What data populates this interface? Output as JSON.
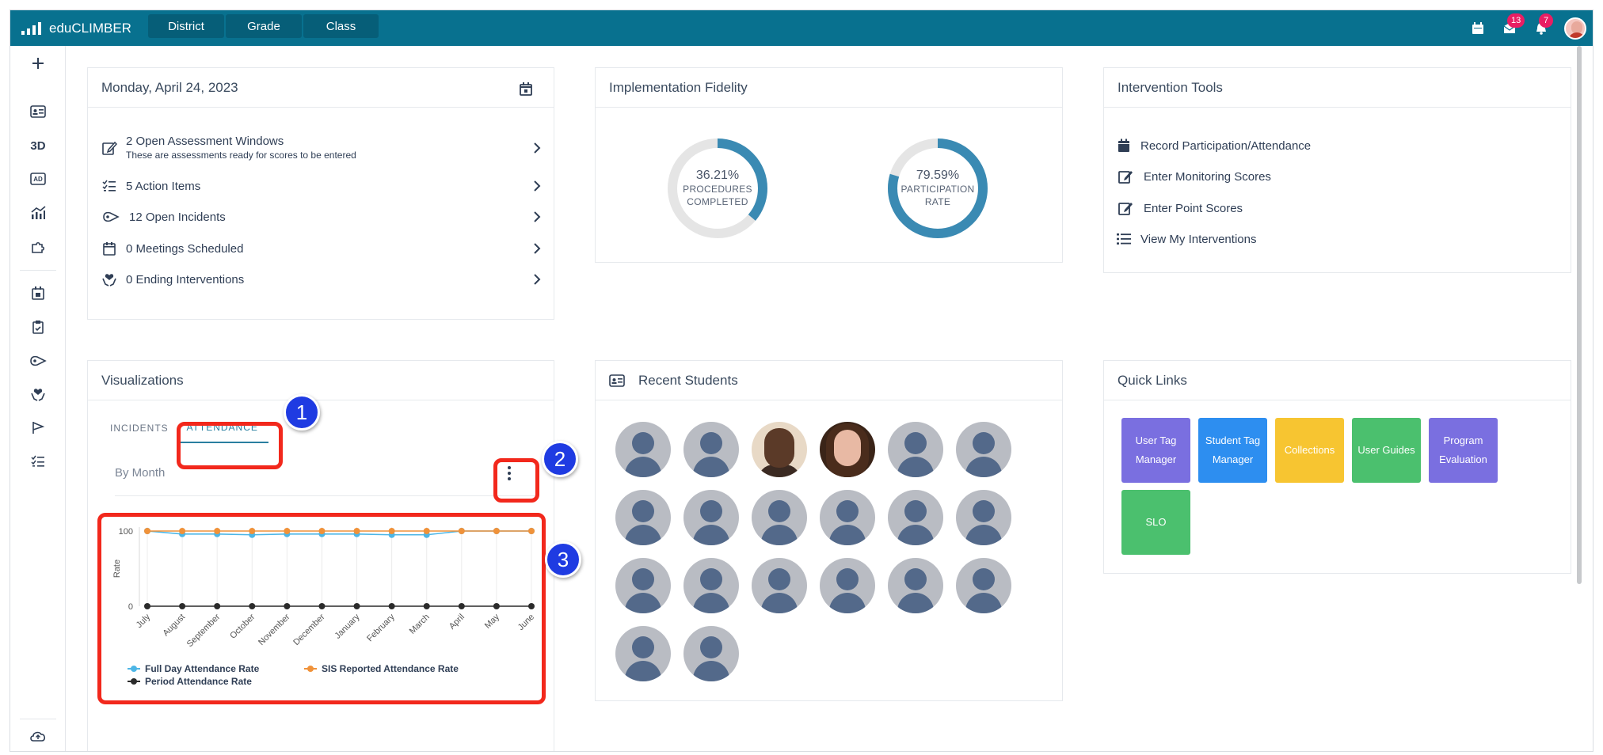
{
  "app": {
    "name": "eduCLIMBER"
  },
  "nav": {
    "tabs": [
      "District",
      "Grade",
      "Class"
    ]
  },
  "topbar": {
    "mail_badge": "13",
    "bell_badge": "7"
  },
  "sidebar": {
    "three_d_label": "3D"
  },
  "today": {
    "date": "Monday, April 24, 2023",
    "items": [
      {
        "label": "2 Open Assessment Windows",
        "sub": "These are assessments ready for scores to be entered"
      },
      {
        "label": "5 Action Items"
      },
      {
        "label": "12 Open Incidents"
      },
      {
        "label": "0 Meetings Scheduled"
      },
      {
        "label": "0 Ending Interventions"
      }
    ]
  },
  "fidelity": {
    "title": "Implementation Fidelity",
    "donuts": [
      {
        "pct_label": "36.21%",
        "line1": "PROCEDURES",
        "line2": "COMPLETED",
        "value": 36.21
      },
      {
        "pct_label": "79.59%",
        "line1": "PARTICIPATION",
        "line2": "RATE",
        "value": 79.59
      }
    ]
  },
  "tools": {
    "title": "Intervention Tools",
    "items": [
      "Record Participation/Attendance",
      "Enter Monitoring Scores",
      "Enter Point Scores",
      "View My Interventions"
    ]
  },
  "viz": {
    "title": "Visualizations",
    "tabs": [
      "INCIDENTS",
      "ATTENDANCE"
    ],
    "subtitle": "By Month",
    "callouts": [
      "1",
      "2",
      "3"
    ]
  },
  "chart_data": {
    "type": "line",
    "categories": [
      "July",
      "August",
      "September",
      "October",
      "November",
      "December",
      "January",
      "February",
      "March",
      "April",
      "May",
      "June"
    ],
    "ylabel": "Rate",
    "ylim": [
      0,
      100
    ],
    "yticks": [
      "100",
      "0"
    ],
    "series": [
      {
        "name": "Full Day Attendance Rate",
        "color": "#4db6e6",
        "values": [
          100,
          96,
          96,
          95,
          96,
          96,
          96,
          95,
          95,
          100,
          100,
          100
        ]
      },
      {
        "name": "SIS Reported Attendance Rate",
        "color": "#f0923a",
        "values": [
          100,
          100,
          100,
          100,
          100,
          100,
          100,
          100,
          100,
          100,
          100,
          100
        ]
      },
      {
        "name": "Period Attendance Rate",
        "color": "#2b2b2b",
        "values": [
          0,
          0,
          0,
          0,
          0,
          0,
          0,
          0,
          0,
          0,
          0,
          0
        ]
      }
    ]
  },
  "students": {
    "title": "Recent Students",
    "count": 20
  },
  "quicklinks": {
    "title": "Quick Links",
    "items": [
      {
        "label": "User Tag Manager",
        "color": "#7a6fe0"
      },
      {
        "label": "Student Tag Manager",
        "color": "#2d8ef0"
      },
      {
        "label": "Collections",
        "color": "#f7c531"
      },
      {
        "label": "User Guides",
        "color": "#4bc06e"
      },
      {
        "label": "Program Evaluation",
        "color": "#7a6fe0"
      },
      {
        "label": "SLO",
        "color": "#4bc06e"
      }
    ]
  }
}
